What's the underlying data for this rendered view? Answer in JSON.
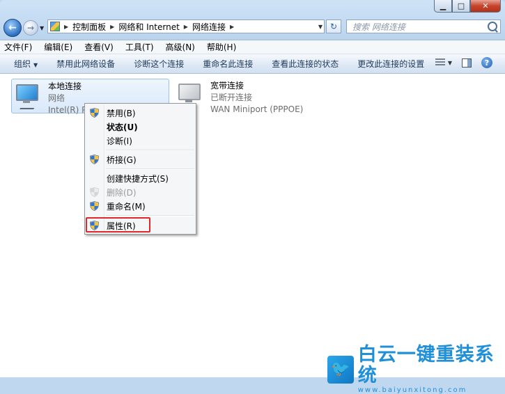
{
  "window": {
    "minimize_glyph": "▁",
    "maximize_glyph": "□",
    "close_glyph": "✕"
  },
  "nav": {
    "back_glyph": "←",
    "forward_glyph": "→",
    "dropdown_glyph": "▼"
  },
  "address": {
    "crumbs": [
      "控制面板",
      "网络和 Internet",
      "网络连接"
    ],
    "separator": "▶",
    "dropdown_glyph": "▼",
    "refresh_glyph": "↻"
  },
  "search": {
    "placeholder": "搜索 网络连接"
  },
  "menubar": [
    "文件(F)",
    "编辑(E)",
    "查看(V)",
    "工具(T)",
    "高级(N)",
    "帮助(H)"
  ],
  "commandbar": {
    "organize": "组织",
    "dropdown_glyph": "▼",
    "items": [
      "禁用此网络设备",
      "诊断这个连接",
      "重命名此连接",
      "查看此连接的状态",
      "更改此连接的设置"
    ],
    "help_glyph": "?"
  },
  "connections": [
    {
      "name": "本地连接",
      "status": "网络",
      "device": "Intel(R) PRO",
      "selected": true
    },
    {
      "name": "宽带连接",
      "status": "已断开连接",
      "device": "WAN Miniport (PPPOE)",
      "selected": false
    }
  ],
  "context_menu": {
    "items": [
      {
        "label": "禁用(B)",
        "shield": true,
        "bold": false,
        "disabled": false
      },
      {
        "label": "状态(U)",
        "shield": false,
        "bold": true,
        "disabled": false
      },
      {
        "label": "诊断(I)",
        "shield": false,
        "bold": false,
        "disabled": false
      },
      {
        "label": "桥接(G)",
        "shield": true,
        "bold": false,
        "disabled": false
      },
      {
        "label": "创建快捷方式(S)",
        "shield": false,
        "bold": false,
        "disabled": false
      },
      {
        "label": "删除(D)",
        "shield": true,
        "bold": false,
        "disabled": true
      },
      {
        "label": "重命名(M)",
        "shield": true,
        "bold": false,
        "disabled": false
      },
      {
        "label": "属性(R)",
        "shield": true,
        "bold": false,
        "disabled": false,
        "highlighted": true
      }
    ]
  },
  "colors": {
    "highlight_border": "#e0272a",
    "brand": "#1f8fd8"
  },
  "watermark": {
    "title": "白云一键重装系统",
    "url": "www.baiyunxitong.com",
    "logo_glyph": "🐦"
  }
}
